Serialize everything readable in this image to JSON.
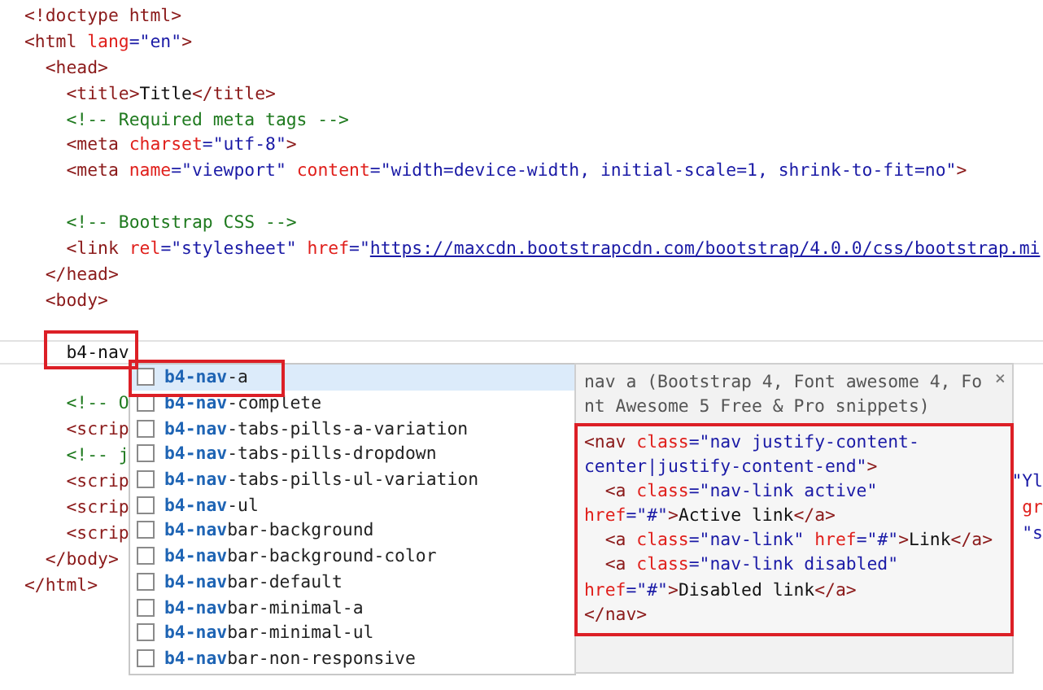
{
  "editor": {
    "lines_before": [
      {
        "kind": "code",
        "tokens": [
          {
            "kind": "tag",
            "text": "<!doctype html>"
          }
        ]
      },
      {
        "kind": "code",
        "tokens": [
          {
            "kind": "tag",
            "text": "<html"
          },
          {
            "kind": "attr",
            "text": " lang"
          },
          {
            "kind": "value",
            "text": "=\"en\""
          },
          {
            "kind": "tag",
            "text": ">"
          }
        ]
      },
      {
        "kind": "code",
        "tokens": [
          {
            "kind": "tag",
            "text": "  <head>"
          }
        ]
      },
      {
        "kind": "code",
        "tokens": [
          {
            "kind": "tag",
            "text": "    <title>"
          },
          {
            "kind": "text",
            "text": "Title"
          },
          {
            "kind": "tag",
            "text": "</title>"
          }
        ]
      },
      {
        "kind": "code",
        "tokens": [
          {
            "kind": "comment",
            "text": "    <!-- Required meta tags -->"
          }
        ]
      },
      {
        "kind": "code",
        "tokens": [
          {
            "kind": "tag",
            "text": "    <meta"
          },
          {
            "kind": "attr",
            "text": " charset"
          },
          {
            "kind": "value",
            "text": "=\"utf-8\""
          },
          {
            "kind": "tag",
            "text": ">"
          }
        ]
      },
      {
        "kind": "code",
        "tokens": [
          {
            "kind": "tag",
            "text": "    <meta"
          },
          {
            "kind": "attr",
            "text": " name"
          },
          {
            "kind": "value",
            "text": "=\"viewport\""
          },
          {
            "kind": "attr",
            "text": " content"
          },
          {
            "kind": "value",
            "text": "=\"width=device-width, initial-scale=1, shrink-to-fit=no\""
          },
          {
            "kind": "tag",
            "text": ">"
          }
        ]
      },
      {
        "kind": "blank"
      },
      {
        "kind": "code",
        "tokens": [
          {
            "kind": "comment",
            "text": "    <!-- Bootstrap CSS -->"
          }
        ]
      },
      {
        "kind": "code",
        "tokens": [
          {
            "kind": "tag",
            "text": "    <link"
          },
          {
            "kind": "attr",
            "text": " rel"
          },
          {
            "kind": "value",
            "text": "=\"stylesheet\""
          },
          {
            "kind": "attr",
            "text": " href"
          },
          {
            "kind": "value",
            "text": "=\""
          },
          {
            "kind": "link",
            "text": "https://maxcdn.bootstrapcdn.com/bootstrap/4.0.0/css/bootstrap.mi"
          }
        ]
      },
      {
        "kind": "code",
        "tokens": [
          {
            "kind": "tag",
            "text": "  </head>"
          }
        ]
      },
      {
        "kind": "code",
        "tokens": [
          {
            "kind": "tag",
            "text": "  <body>"
          }
        ]
      },
      {
        "kind": "blank"
      }
    ],
    "current_line": {
      "tokens": [
        {
          "kind": "text",
          "text": "    b4-nav"
        }
      ]
    },
    "lines_after": [
      {
        "kind": "blank"
      },
      {
        "kind": "code",
        "tokens": [
          {
            "kind": "comment",
            "text": "    <!-- O"
          }
        ]
      },
      {
        "kind": "code",
        "tokens": [
          {
            "kind": "tag",
            "text": "    <scrip"
          }
        ]
      },
      {
        "kind": "code",
        "tokens": [
          {
            "kind": "comment",
            "text": "    <!-- j"
          }
        ]
      },
      {
        "kind": "code",
        "tokens": [
          {
            "kind": "tag",
            "text": "    <scrip"
          }
        ],
        "right_fragment": {
          "kind": "value",
          "text": "\"Yl"
        }
      },
      {
        "kind": "code",
        "tokens": [
          {
            "kind": "tag",
            "text": "    <scrip"
          }
        ],
        "right_fragment": {
          "kind": "attr",
          "text": "gr"
        }
      },
      {
        "kind": "code",
        "tokens": [
          {
            "kind": "tag",
            "text": "    <scrip"
          }
        ],
        "right_fragment": {
          "kind": "value",
          "text": "\"s"
        }
      },
      {
        "kind": "code",
        "tokens": [
          {
            "kind": "tag",
            "text": "  </body>"
          }
        ]
      },
      {
        "kind": "code",
        "tokens": [
          {
            "kind": "tag",
            "text": "</html>"
          }
        ]
      }
    ]
  },
  "completion": {
    "items": [
      {
        "match": "b4-nav",
        "rest": "-a",
        "selected": true
      },
      {
        "match": "b4-nav",
        "rest": "-complete",
        "selected": false
      },
      {
        "match": "b4-nav",
        "rest": "-tabs-pills-a-variation",
        "selected": false
      },
      {
        "match": "b4-nav",
        "rest": "-tabs-pills-dropdown",
        "selected": false
      },
      {
        "match": "b4-nav",
        "rest": "-tabs-pills-ul-variation",
        "selected": false
      },
      {
        "match": "b4-nav",
        "rest": "-ul",
        "selected": false
      },
      {
        "match": "b4-nav",
        "rest": "bar-background",
        "selected": false
      },
      {
        "match": "b4-nav",
        "rest": "bar-background-color",
        "selected": false
      },
      {
        "match": "b4-nav",
        "rest": "bar-default",
        "selected": false
      },
      {
        "match": "b4-nav",
        "rest": "bar-minimal-a",
        "selected": false
      },
      {
        "match": "b4-nav",
        "rest": "bar-minimal-ul",
        "selected": false
      },
      {
        "match": "b4-nav",
        "rest": "bar-non-responsive",
        "selected": false
      }
    ]
  },
  "tooltip": {
    "description_lines": [
      "nav a (Bootstrap 4, Font awesome 4, Fo",
      "nt Awesome 5 Free & Pro snippets)"
    ],
    "close": "×",
    "preview_lines": [
      {
        "tokens": [
          {
            "kind": "tag",
            "text": "<nav"
          },
          {
            "kind": "attr",
            "text": " class"
          },
          {
            "kind": "value",
            "text": "=\"nav justify-content-"
          }
        ]
      },
      {
        "tokens": [
          {
            "kind": "value",
            "text": "center|justify-content-end\""
          },
          {
            "kind": "tag",
            "text": ">"
          }
        ]
      },
      {
        "tokens": [
          {
            "kind": "tag",
            "text": "  <a"
          },
          {
            "kind": "attr",
            "text": " class"
          },
          {
            "kind": "value",
            "text": "=\"nav-link active\""
          }
        ]
      },
      {
        "tokens": [
          {
            "kind": "attr",
            "text": "href"
          },
          {
            "kind": "value",
            "text": "=\"#\""
          },
          {
            "kind": "tag",
            "text": ">"
          },
          {
            "kind": "text",
            "text": "Active link"
          },
          {
            "kind": "tag",
            "text": "</a>"
          }
        ]
      },
      {
        "tokens": [
          {
            "kind": "tag",
            "text": "  <a"
          },
          {
            "kind": "attr",
            "text": " class"
          },
          {
            "kind": "value",
            "text": "=\"nav-link\""
          },
          {
            "kind": "attr",
            "text": " href"
          },
          {
            "kind": "value",
            "text": "=\"#\""
          },
          {
            "kind": "tag",
            "text": ">"
          },
          {
            "kind": "text",
            "text": "Link"
          },
          {
            "kind": "tag",
            "text": "</a>"
          }
        ]
      },
      {
        "tokens": [
          {
            "kind": "tag",
            "text": "  <a"
          },
          {
            "kind": "attr",
            "text": " class"
          },
          {
            "kind": "value",
            "text": "=\"nav-link disabled\""
          }
        ]
      },
      {
        "tokens": [
          {
            "kind": "attr",
            "text": "href"
          },
          {
            "kind": "value",
            "text": "=\"#\""
          },
          {
            "kind": "tag",
            "text": ">"
          },
          {
            "kind": "text",
            "text": "Disabled link"
          },
          {
            "kind": "tag",
            "text": "</a>"
          }
        ]
      },
      {
        "tokens": [
          {
            "kind": "tag",
            "text": "</nav>"
          }
        ]
      }
    ]
  }
}
